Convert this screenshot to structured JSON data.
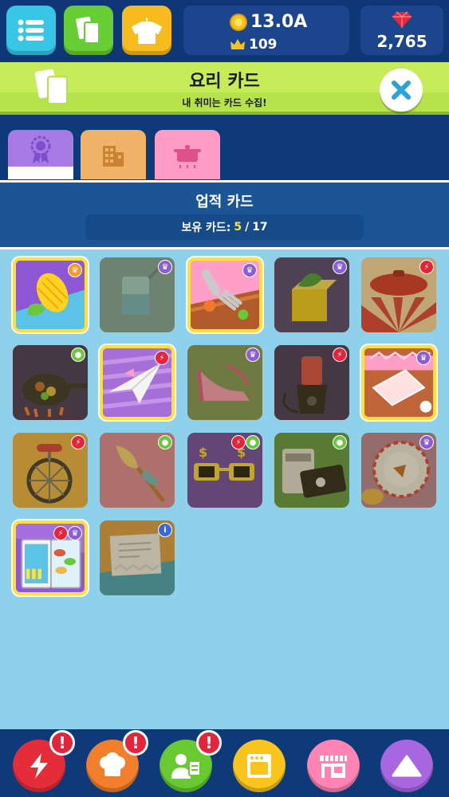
{
  "resources": {
    "coins": "13.0A",
    "crowns": "109",
    "gems": "2,765"
  },
  "banner": {
    "title": "요리 카드",
    "subtitle": "내 취미는 카드 수집!"
  },
  "tabs": [
    {
      "name": "achievement",
      "icon": "ribbon-icon",
      "active": true
    },
    {
      "name": "building",
      "icon": "building-icon",
      "active": false
    },
    {
      "name": "cooking",
      "icon": "pot-icon",
      "active": false
    }
  ],
  "section": {
    "title": "업적 카드",
    "owned_label": "보유 카드:",
    "owned_count": "5",
    "separator": "/",
    "total_count": "17"
  },
  "cards": [
    {
      "id": "corn",
      "owned": true,
      "badge": "crown-icon"
    },
    {
      "id": "beaker",
      "owned": false,
      "badge": "crown-icon"
    },
    {
      "id": "fork",
      "owned": true,
      "badge": "crown-icon"
    },
    {
      "id": "cash-box",
      "owned": false,
      "badge": "crown-icon"
    },
    {
      "id": "pot-lid",
      "owned": false,
      "badge": "lightning-icon"
    },
    {
      "id": "frying-pan",
      "owned": false,
      "badge": "person-icon"
    },
    {
      "id": "paper-plane",
      "owned": true,
      "badge": "lightning-icon"
    },
    {
      "id": "high-heel",
      "owned": false,
      "badge": "crown-icon"
    },
    {
      "id": "blender",
      "owned": false,
      "badge": "lightning-icon"
    },
    {
      "id": "napkin",
      "owned": true,
      "badge": "crown-icon"
    },
    {
      "id": "unicycle",
      "owned": false,
      "badge": "lightning-icon"
    },
    {
      "id": "feather-duster",
      "owned": false,
      "badge": "person-icon"
    },
    {
      "id": "dollar-glasses",
      "owned": false,
      "badge": "lightning-icon"
    },
    {
      "id": "black-card",
      "owned": false,
      "badge": "person-icon"
    },
    {
      "id": "plate",
      "owned": false,
      "badge": "crown-icon"
    },
    {
      "id": "fridge",
      "owned": true,
      "badge": "lightning-icon"
    },
    {
      "id": "letter",
      "owned": false,
      "badge": "info-icon"
    }
  ],
  "bottom_nav": [
    {
      "name": "boost",
      "icon": "lightning-icon",
      "color": "#e52d3a",
      "alert": "!"
    },
    {
      "name": "chefs",
      "icon": "chef-hat-icon",
      "color": "#f37e2b",
      "alert": "!"
    },
    {
      "name": "managers",
      "icon": "manager-icon",
      "color": "#69c931",
      "alert": "!"
    },
    {
      "name": "kitchen",
      "icon": "oven-icon",
      "color": "#f9c51d",
      "alert": ""
    },
    {
      "name": "shop",
      "icon": "shop-icon",
      "color": "#ff84b3",
      "alert": ""
    },
    {
      "name": "upgrade",
      "icon": "triangle-up-icon",
      "color": "#a867e1",
      "alert": ""
    }
  ],
  "colors": {
    "background": "#0f3a7a",
    "grid": "#8fd0ea",
    "banner": "#c6ec5a",
    "owned_border": "#ffe03a",
    "highlight": "#ffe23a"
  }
}
